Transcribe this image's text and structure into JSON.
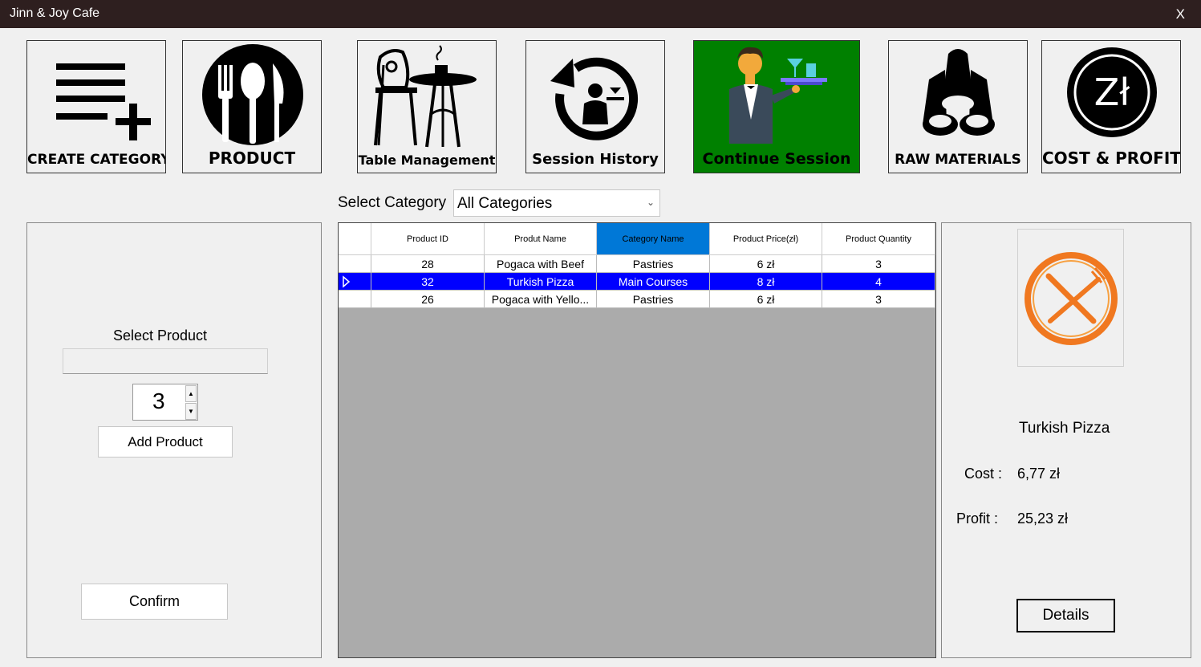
{
  "window": {
    "title": "Jinn & Joy Cafe",
    "close_label": "X"
  },
  "toolbar": {
    "create_category": "CREATE CATEGORY",
    "product": "PRODUCT",
    "table_management": "Table Management",
    "session_history": "Session History",
    "continue_session": "Continue Session",
    "raw_materials": "RAW MATERIALS",
    "cost_profit": "COST & PROFIT",
    "currency_symbol": "Zł"
  },
  "category_filter": {
    "label": "Select Category",
    "value": "All Categories"
  },
  "left_panel": {
    "select_product_label": "Select Product",
    "select_product_value": "",
    "quantity": "3",
    "add_product_label": "Add Product",
    "confirm_label": "Confirm"
  },
  "grid": {
    "columns": [
      "Product ID",
      "Produt Name",
      "Category Name",
      "Product Price(zł)",
      "Product Quantity"
    ],
    "selected_column": "Category Name",
    "rows": [
      [
        "28",
        "Pogaca with Beef",
        "Pastries",
        "6 zł",
        "3"
      ],
      [
        "32",
        "Turkish Pizza",
        "Main Courses",
        "8 zł",
        "4"
      ],
      [
        "26",
        "Pogaca with Yello...",
        "Pastries",
        "6 zł",
        "3"
      ]
    ],
    "selected_row": 1
  },
  "right_panel": {
    "product_name": "Turkish Pizza",
    "cost_label": "Cost :",
    "cost_value": "6,77 zł",
    "profit_label": "Profit :",
    "profit_value": "25,23 zł",
    "details_label": "Details"
  },
  "colors": {
    "titlebar": "#2e1f1f",
    "continue_session_bg": "#008000",
    "selected_row": "#0000ff",
    "selected_header": "#0078d7",
    "logo_orange": "#f07820"
  },
  "icons": [
    "list-add-icon",
    "cutlery-icon",
    "cafe-table-icon",
    "history-waiter-icon",
    "waiter-icon",
    "raw-materials-icon",
    "zloty-icon",
    "restaurant-logo-icon"
  ]
}
